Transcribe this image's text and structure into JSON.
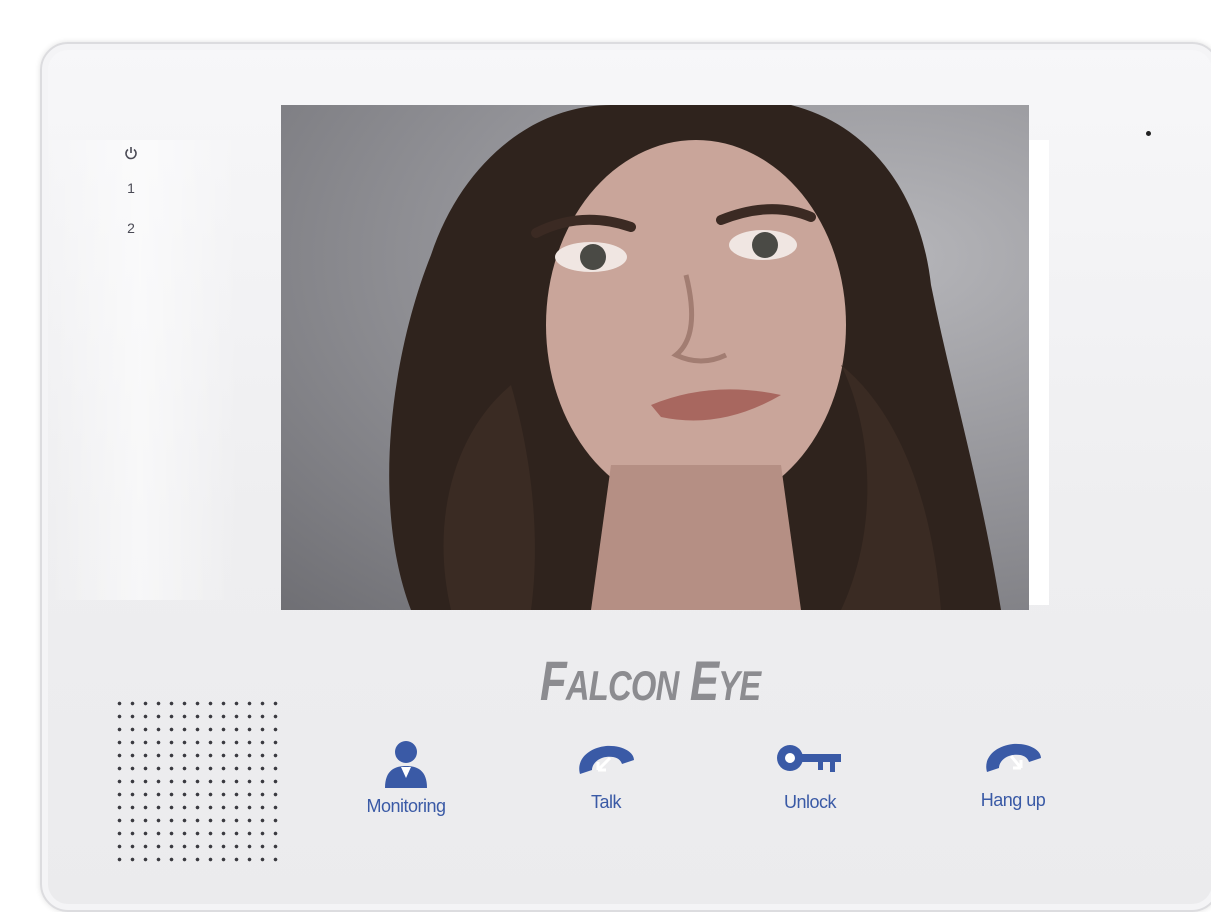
{
  "device": {
    "brand_part1_large": "F",
    "brand_part1_small": "ALCON",
    "brand_part2_large": " E",
    "brand_part2_small": "YE"
  },
  "indicators": {
    "led_1": "1",
    "led_2": "2",
    "power_icon": "power-icon"
  },
  "buttons": [
    {
      "label": "Monitoring",
      "icon": "person-icon"
    },
    {
      "label": "Talk",
      "icon": "handset-icon"
    },
    {
      "label": "Unlock",
      "icon": "key-icon"
    },
    {
      "label": "Hang up",
      "icon": "handset-hangup-icon"
    }
  ],
  "colors": {
    "button_blue": "#3a5aa6",
    "brand_gray": "#8c8c90"
  }
}
